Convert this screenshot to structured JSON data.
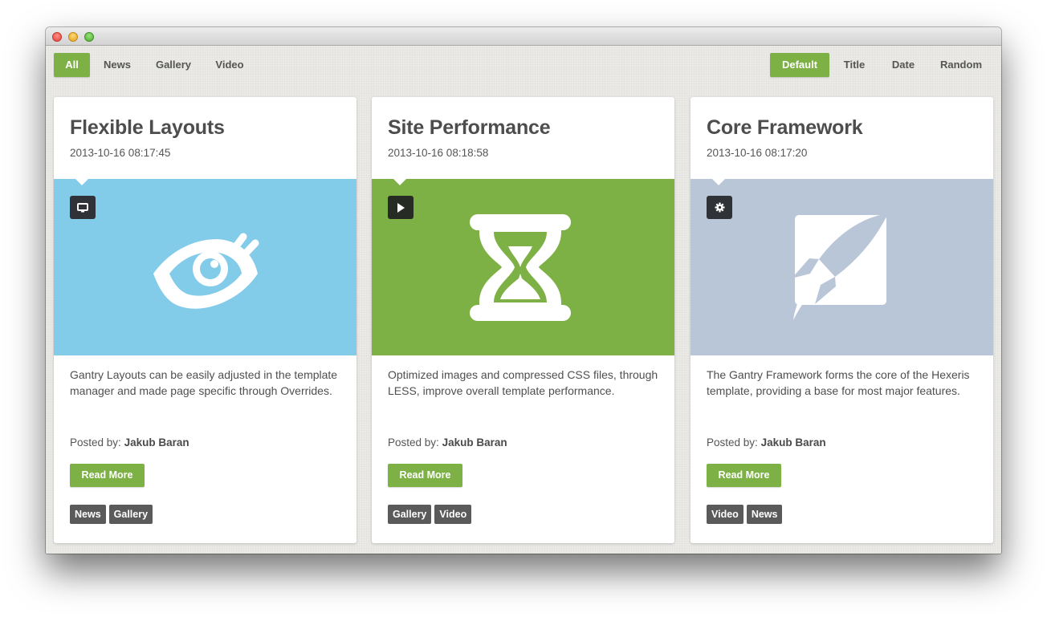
{
  "filters": {
    "categories": [
      "All",
      "News",
      "Gallery",
      "Video"
    ],
    "active_category": "All",
    "sort_options": [
      "Default",
      "Title",
      "Date",
      "Random"
    ],
    "active_sort": "Default"
  },
  "cards": [
    {
      "title": "Flexible Layouts",
      "date": "2013-10-16 08:17:45",
      "media_color": "#82cbe9",
      "badge_icon": "monitor-icon",
      "main_icon": "eye-icon",
      "description": "Gantry Layouts can be easily adjusted in the template manager and made page specific through Overrides.",
      "posted_label": "Posted by:",
      "author": "Jakub Baran",
      "read_more": "Read More",
      "tags": [
        "News",
        "Gallery"
      ]
    },
    {
      "title": "Site Performance",
      "date": "2013-10-16 08:18:58",
      "media_color": "#7db146",
      "badge_icon": "play-icon",
      "main_icon": "hourglass-icon",
      "description": "Optimized images and compressed CSS files, through LESS, improve overall template performance.",
      "posted_label": "Posted by:",
      "author": "Jakub Baran",
      "read_more": "Read More",
      "tags": [
        "Gallery",
        "Video"
      ]
    },
    {
      "title": "Core Framework",
      "date": "2013-10-16 08:17:20",
      "media_color": "#b9c6d7",
      "badge_icon": "gear-icon",
      "main_icon": "rocket-icon",
      "description": "The Gantry Framework forms the core of the Hexeris template, providing a base for most major features.",
      "posted_label": "Posted by:",
      "author": "Jakub Baran",
      "read_more": "Read More",
      "tags": [
        "Video",
        "News"
      ]
    }
  ],
  "colors": {
    "accent_green": "#7db146",
    "tag_gray": "#5a5a5a",
    "badge_dark": "#2f3236"
  }
}
